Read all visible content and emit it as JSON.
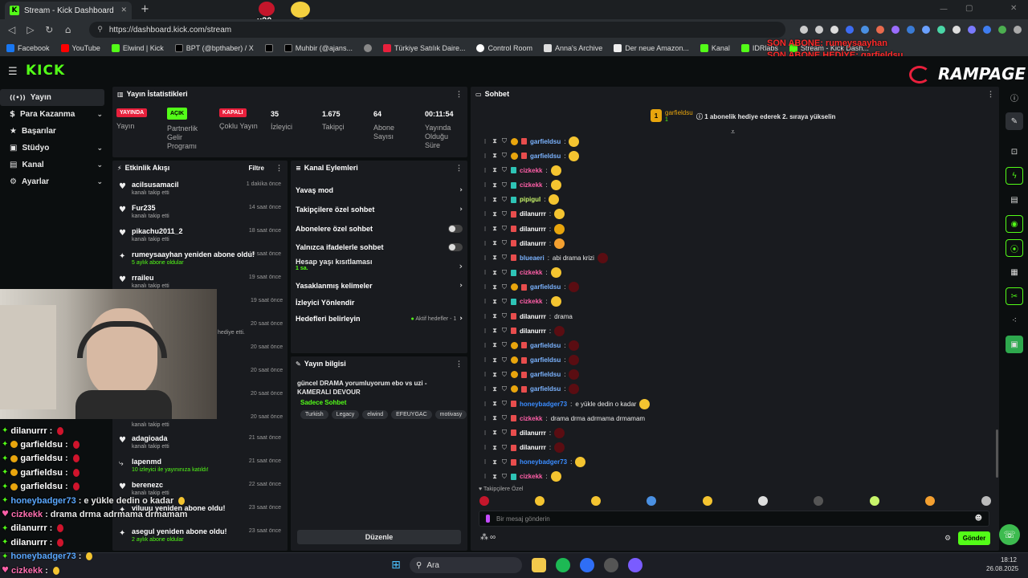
{
  "browser": {
    "tab_title": "Stream - Kick Dashboard",
    "tab_close": "✕",
    "new_tab": "+",
    "url": "https://dashboard.kick.com/stream",
    "bookmarks": [
      "Facebook",
      "YouTube",
      "Elwind | Kick",
      "BPT (@bpthaber) / X",
      "Muhbir (@ajans...",
      "Türkiye Satılık Daire...",
      "Control Room",
      "Anna's Archive",
      "Der neue Amazon...",
      "Kanal",
      "IDRlabs",
      "Stream - Kick Dash..."
    ]
  },
  "overlay": {
    "top_counts": [
      "x20",
      "x5"
    ],
    "last_sub": "SON ABONE: rumeysaayhan",
    "last_gift": "SON ABONE HEDİYE: garfieldsu",
    "brand": "RAMPAGE"
  },
  "kick": {
    "logo": "KICK"
  },
  "sidebar": {
    "items": [
      {
        "label": "Yayın",
        "icon": "((•))"
      },
      {
        "label": "Para Kazanma",
        "icon": "$"
      },
      {
        "label": "Başarılar",
        "icon": "★"
      },
      {
        "label": "Stüdyo",
        "icon": "▣"
      },
      {
        "label": "Kanal",
        "icon": "▤"
      },
      {
        "label": "Ayarlar",
        "icon": "⚙"
      }
    ]
  },
  "stats": {
    "title": "Yayın İstatistikleri",
    "live_badge": "YAYINDA",
    "live_label": "Yayın",
    "partner_badge": "AÇIK",
    "partner_label": "Partnerlik Gelir Programı",
    "multi_badge": "KAPALI",
    "multi_label": "Çoklu Yayın",
    "viewers_value": "35",
    "viewers_label": "İzleyici",
    "followers_value": "1.675",
    "followers_label": "Takipçi",
    "subs_value": "64",
    "subs_label": "Abone Sayısı",
    "uptime_value": "00:11:54",
    "uptime_label": "Yayında Olduğu Süre"
  },
  "activity": {
    "title": "Etkinlik Akışı",
    "filter": "Filtre",
    "items": [
      {
        "name": "acilsusamacil",
        "sub": "kanalı takip etti",
        "time": "1 dakika önce",
        "icon": "♥"
      },
      {
        "name": "Fur235",
        "sub": "kanalı takip etti",
        "time": "14 saat önce",
        "icon": "♥"
      },
      {
        "name": "pikachu2011_2",
        "sub": "kanalı takip etti",
        "time": "18 saat önce",
        "icon": "♥"
      },
      {
        "name": "rumeysaayhan yeniden abone oldu!",
        "sub": "5 aylık abone oldular",
        "time": "19 saat önce",
        "icon": "✦"
      },
      {
        "name": "rraileu",
        "sub": "kanalı takip etti",
        "time": "19 saat önce",
        "icon": "♥"
      }
    ],
    "partial_times": [
      "19 saat önce",
      "20 saat önce",
      "20 saat önce",
      "20 saat önce",
      "20 saat önce",
      "20 saat önce"
    ],
    "partial_text": "hediye etti.",
    "lower_sub": "kanalı takip etti",
    "lower_items": [
      {
        "name": "adagioada",
        "sub": "kanalı takip etti",
        "time": "21 saat önce",
        "icon": "♥"
      },
      {
        "name": "lapenmd",
        "sub": "10 izleyici ile yayınınıza katıldı!",
        "time": "21 saat önce",
        "icon": "⤷"
      },
      {
        "name": "berenezc",
        "sub": "kanalı takip etti",
        "time": "22 saat önce",
        "icon": "♥"
      },
      {
        "name": "viluuu yeniden abone oldu!",
        "sub": "",
        "time": "23 saat önce",
        "icon": "✦"
      },
      {
        "name": "asegul yeniden abone oldu!",
        "sub": "2 aylık abone oldular",
        "time": "23 saat önce",
        "icon": "✦"
      }
    ]
  },
  "channel_actions": {
    "title": "Kanal Eylemleri",
    "items": [
      {
        "label": "Yavaş mod",
        "control": "›"
      },
      {
        "label": "Takipçilere özel sohbet",
        "control": "›"
      },
      {
        "label": "Abonelere özel sohbet",
        "control": "toggle"
      },
      {
        "label": "Yalnızca ifadelerle sohbet",
        "control": "toggle"
      }
    ],
    "age_label": "Hesap yaşı kısıtlaması",
    "age_value": "1 sa.",
    "banned_words": "Yasaklanmış kelimeler",
    "viewer_redirect": "İzleyici Yönlendir",
    "goals": "Hedefleri belirleyin",
    "goals_status": "Aktif hedefler - 1"
  },
  "stream_info": {
    "title": "Yayın bilgisi",
    "stream_title": "güncel DRAMA yorumluyorum ebo vs uzi - KAMERALI DEVOUR",
    "category": "Sadece Sohbet",
    "tags": [
      "Turkish",
      "Legacy",
      "elwind",
      "EFEUYGAC",
      "motivasy"
    ],
    "edit_button": "Düzenle"
  },
  "chat": {
    "title": "Sohbet",
    "pinned_user": "garfieldsu",
    "pinned_count": "1",
    "pinned_text": "1 abonelik hediye ederek 2. sıraya yükselin",
    "followers_only": "Takipçilere Özel",
    "input_placeholder": "Bir mesaj gönderin",
    "send_button": "Gönder",
    "infinity": "∞",
    "messages": [
      {
        "user": "garfieldsu",
        "color": "#7bb3ff",
        "text": "",
        "coin": true,
        "sub": "#e84d4d",
        "emote": "#f4c430"
      },
      {
        "user": "garfieldsu",
        "color": "#7bb3ff",
        "text": "",
        "coin": true,
        "sub": "#e84d4d",
        "emote": "#f4c430"
      },
      {
        "user": "cizkekk",
        "color": "#ff5fa8",
        "text": "",
        "coin": false,
        "sub": "#2ec4b6",
        "emote": "#f4c430"
      },
      {
        "user": "cizkekk",
        "color": "#ff5fa8",
        "text": "",
        "coin": false,
        "sub": "#2ec4b6",
        "emote": "#f4c430"
      },
      {
        "user": "pipigul",
        "color": "#c8f56a",
        "text": "",
        "coin": false,
        "sub": "#2ec4b6",
        "emote": "#f4c430"
      },
      {
        "user": "dilanurrr",
        "color": "#ffffff",
        "text": "",
        "coin": false,
        "sub": "#e84d4d",
        "emote": "#f4c430"
      },
      {
        "user": "dilanurrr",
        "color": "#ffffff",
        "text": "",
        "coin": false,
        "sub": "#e84d4d",
        "emote": "#e8a50d"
      },
      {
        "user": "dilanurrr",
        "color": "#ffffff",
        "text": "",
        "coin": false,
        "sub": "#e84d4d",
        "emote": "#f4a030"
      },
      {
        "user": "blueaeri",
        "color": "#7bb3ff",
        "text": "abi drama krizi",
        "coin": false,
        "sub": "#e84d4d",
        "emote": "#5a0d12"
      },
      {
        "user": "cizkekk",
        "color": "#ff5fa8",
        "text": "",
        "coin": false,
        "sub": "#2ec4b6",
        "emote": "#f4c430"
      },
      {
        "user": "garfieldsu",
        "color": "#7bb3ff",
        "text": "",
        "coin": true,
        "sub": "#e84d4d",
        "emote": "#5a0d12"
      },
      {
        "user": "cizkekk",
        "color": "#ff5fa8",
        "text": "",
        "coin": false,
        "sub": "#2ec4b6",
        "emote": "#f4c430"
      },
      {
        "user": "dilanurrr",
        "color": "#ffffff",
        "text": "drama",
        "coin": false,
        "sub": "#e84d4d",
        "emote": ""
      },
      {
        "user": "dilanurrr",
        "color": "#ffffff",
        "text": "",
        "coin": false,
        "sub": "#e84d4d",
        "emote": "#5a0d12"
      },
      {
        "user": "garfieldsu",
        "color": "#7bb3ff",
        "text": "",
        "coin": true,
        "sub": "#e84d4d",
        "emote": "#5a0d12"
      },
      {
        "user": "garfieldsu",
        "color": "#7bb3ff",
        "text": "",
        "coin": true,
        "sub": "#e84d4d",
        "emote": "#5a0d12"
      },
      {
        "user": "garfieldsu",
        "color": "#7bb3ff",
        "text": "",
        "coin": true,
        "sub": "#e84d4d",
        "emote": "#5a0d12"
      },
      {
        "user": "garfieldsu",
        "color": "#7bb3ff",
        "text": "",
        "coin": true,
        "sub": "#e84d4d",
        "emote": "#5a0d12"
      },
      {
        "user": "honeybadger73",
        "color": "#3a8cff",
        "text": "e yükle dedin o kadar",
        "coin": false,
        "sub": "#e84d4d",
        "emote": "#f4c430"
      },
      {
        "user": "cizkekk",
        "color": "#ff5fa8",
        "text": "drama drma adrmama drmamam",
        "coin": false,
        "sub": "#e84d4d",
        "emote": ""
      },
      {
        "user": "dilanurrr",
        "color": "#ffffff",
        "text": "",
        "coin": false,
        "sub": "#e84d4d",
        "emote": "#5a0d12"
      },
      {
        "user": "dilanurrr",
        "color": "#ffffff",
        "text": "",
        "coin": false,
        "sub": "#e84d4d",
        "emote": "#5a0d12"
      },
      {
        "user": "honeybadger73",
        "color": "#3a8cff",
        "text": "",
        "coin": false,
        "sub": "#e84d4d",
        "emote": "#f4c430"
      },
      {
        "user": "cizkekk",
        "color": "#ff5fa8",
        "text": "",
        "coin": false,
        "sub": "#2ec4b6",
        "emote": "#f4c430"
      }
    ]
  },
  "overlay_chat": [
    {
      "user": "dilanurrr",
      "color": "#ffffff",
      "text": "",
      "coin": false,
      "icon": "✦",
      "emote": "#d0142c"
    },
    {
      "user": "garfieldsu",
      "color": "#ffffff",
      "text": "",
      "coin": true,
      "icon": "✦",
      "emote": "#d0142c"
    },
    {
      "user": "garfieldsu",
      "color": "#ffffff",
      "text": "",
      "coin": true,
      "icon": "✦",
      "emote": "#d0142c"
    },
    {
      "user": "garfieldsu",
      "color": "#ffffff",
      "text": "",
      "coin": true,
      "icon": "✦",
      "emote": "#d0142c"
    },
    {
      "user": "garfieldsu",
      "color": "#ffffff",
      "text": "",
      "coin": true,
      "icon": "✦",
      "emote": "#d0142c"
    },
    {
      "user": "honeybadger73",
      "color": "#5aa8ff",
      "text": "e yükle dedin o kadar",
      "coin": false,
      "icon": "✦",
      "emote": "#f4c430"
    },
    {
      "user": "cizkekk",
      "color": "#ff6fb0",
      "text": "drama drma adrmama drmamam",
      "coin": false,
      "icon": "♥",
      "emote": ""
    },
    {
      "user": "dilanurrr",
      "color": "#ffffff",
      "text": "",
      "coin": false,
      "icon": "✦",
      "emote": "#d0142c"
    },
    {
      "user": "dilanurrr",
      "color": "#ffffff",
      "text": "",
      "coin": false,
      "icon": "✦",
      "emote": "#d0142c"
    },
    {
      "user": "honeybadger73",
      "color": "#5aa8ff",
      "text": "",
      "coin": false,
      "icon": "✦",
      "emote": "#f4c430"
    },
    {
      "user": "cizkekk",
      "color": "#ff6fb0",
      "text": "",
      "coin": false,
      "icon": "♥",
      "emote": "#f4c430"
    }
  ],
  "taskbar": {
    "search": "Ara",
    "time": "18:12",
    "date": "26.08.2025"
  },
  "colors": {
    "kick_green": "#53fc18",
    "panel": "#191b1f",
    "bg": "#0b0e0f",
    "live_red": "#e8203c"
  }
}
